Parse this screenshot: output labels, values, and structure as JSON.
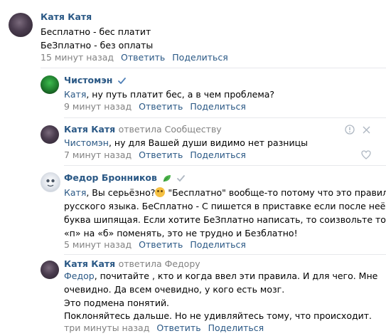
{
  "comments": [
    {
      "author": "Катя Катя",
      "lines": [
        "Бесплатно - бес платит",
        "БеЗплатно - без оплаты"
      ],
      "time": "15 минут назад",
      "reply_label": "Ответить",
      "share_label": "Поделиться"
    },
    {
      "author": "Чистомэн",
      "mention": "Катя",
      "line1_rest": ", ну путь платит бес, а в чем проблема?",
      "time": "9 минут назад",
      "reply_label": "Ответить",
      "share_label": "Поделиться"
    },
    {
      "author": "Катя Катя",
      "replied_word": "ответила",
      "replied_to": "Сообществу",
      "mention": "Чистомэн",
      "line1_rest": ", ну для Вашей души видимо нет разницы",
      "time": "7 минут назад",
      "reply_label": "Ответить",
      "share_label": "Поделиться"
    },
    {
      "author": "Федор Бронников",
      "mention": "Катя",
      "line1_rest": ", Вы серьёзно?",
      "line1_tail": " \"Бесплатно\" вообще-то потому что это правила",
      "lines": [
        "русского языка. БеСплатно - С пишется в приставке если после неё",
        "буква шипящая. Если хотите БеЗплатно написать, то соизвольте тогда",
        "«п» на «б» поменять, это не трудно и Безблатно!"
      ],
      "time": "5 минут назад",
      "reply_label": "Ответить",
      "share_label": "Поделиться"
    },
    {
      "author": "Катя Катя",
      "replied_word": "ответила",
      "replied_to": "Федору",
      "mention": "Федор",
      "line1_rest": ", почитайте , кто и когда ввел эти правила. И для чего. Мне",
      "lines": [
        "очевидно. Да всем очевидно, у кого есть мозг.",
        "Это подмена понятий.",
        "Поклоняйтесь дальше. Но не удивляйтесь тому, что происходит."
      ],
      "time": "три минуты назад",
      "reply_label": "Ответить",
      "share_label": "Поделиться"
    }
  ],
  "colors": {
    "link": "#2a5885",
    "meta": "#828282",
    "divider": "#e7e8ec",
    "verified": "#5181b8",
    "leaf": "#4bb34b"
  }
}
